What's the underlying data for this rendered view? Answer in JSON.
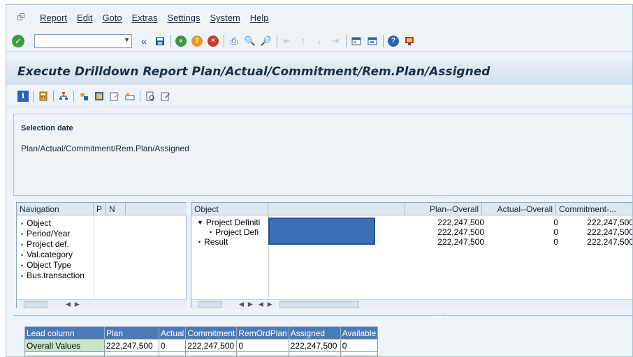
{
  "menu": {
    "items": [
      "Report",
      "Edit",
      "Goto",
      "Extras",
      "Settings",
      "System",
      "Help"
    ]
  },
  "toolbar": {
    "command_value": "",
    "back_glyph": "«"
  },
  "title": "Execute Drilldown Report Plan/Actual/Commitment/Rem.Plan/Assigned",
  "selection": {
    "label": "Selection date",
    "value": "Plan/Actual/Commitment/Rem.Plan/Assigned"
  },
  "navigation": {
    "header": "Navigation",
    "col_p": "P",
    "col_n": "N",
    "items": [
      "Object",
      "Period/Year",
      "Project def.",
      "Val.category",
      "Object Type",
      "Bus.transaction"
    ]
  },
  "object_table": {
    "headers": {
      "object": "Object",
      "plan": "Plan--Overall",
      "actual": "Actual--Overall",
      "commitment": "Commitment-..."
    },
    "rows": [
      {
        "label": "Project Definiti",
        "plan": "222,247,500",
        "actual": "0",
        "commitment": "222,247,500",
        "expanded": true
      },
      {
        "label": "Project Defi",
        "plan": "222,247,500",
        "actual": "0",
        "commitment": "222,247,500"
      },
      {
        "label": "Result",
        "plan": "222,247,500",
        "actual": "0",
        "commitment": "222,247,500"
      }
    ]
  },
  "lead_table": {
    "headers": [
      "Lead column",
      "Plan",
      "Actual",
      "Commitment",
      "RemOrdPlan",
      "Assigned",
      "Available"
    ],
    "row": [
      "Overall Values",
      "222,247,500",
      "0",
      "222,247,500",
      "0",
      "222,247,500",
      "0"
    ]
  },
  "colors": {
    "header_blue": "#4a7bb5",
    "redaction": "#3a6fb8",
    "highlight_green": "#c9e4c9"
  }
}
